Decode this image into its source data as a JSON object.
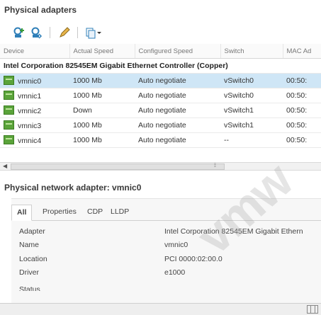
{
  "page": {
    "title": "Physical adapters",
    "watermark_text": "vmw"
  },
  "toolbar": {
    "icons": [
      "add-networking-icon",
      "refresh-icon",
      "edit-icon",
      "actions-dropdown-icon"
    ]
  },
  "table": {
    "columns": [
      "Device",
      "Actual Speed",
      "Configured Speed",
      "Switch",
      "MAC Ad"
    ],
    "group_label": "Intel Corporation 82545EM Gigabit Ethernet Controller (Copper)",
    "rows": [
      {
        "device": "vmnic0",
        "speed": "1000 Mb",
        "configured": "Auto negotiate",
        "switch": "vSwitch0",
        "mac": "00:50:",
        "selected": true
      },
      {
        "device": "vmnic1",
        "speed": "1000 Mb",
        "configured": "Auto negotiate",
        "switch": "vSwitch0",
        "mac": "00:50:",
        "selected": false
      },
      {
        "device": "vmnic2",
        "speed": "Down",
        "configured": "Auto negotiate",
        "switch": "vSwitch1",
        "mac": "00:50:",
        "selected": false
      },
      {
        "device": "vmnic3",
        "speed": "1000 Mb",
        "configured": "Auto negotiate",
        "switch": "vSwitch1",
        "mac": "00:50:",
        "selected": false
      },
      {
        "device": "vmnic4",
        "speed": "1000 Mb",
        "configured": "Auto negotiate",
        "switch": "--",
        "mac": "00:50:",
        "selected": false
      }
    ]
  },
  "detail": {
    "title": "Physical network adapter: vmnic0",
    "tabs": [
      "All",
      "Properties",
      "CDP",
      "LLDP"
    ],
    "active_tab": "All",
    "properties": [
      {
        "label": "Adapter",
        "value": "Intel Corporation 82545EM Gigabit Ethern"
      },
      {
        "label": "Name",
        "value": "vmnic0"
      },
      {
        "label": "Location",
        "value": "PCI 0000:02:00.0"
      },
      {
        "label": "Driver",
        "value": "e1000"
      },
      {
        "label": "Status",
        "value": ""
      }
    ]
  },
  "colors": {
    "selected_row": "#cfe6f6",
    "nic_icon": "#5aa33a",
    "toolbar_icon": "#2f7fb8"
  }
}
